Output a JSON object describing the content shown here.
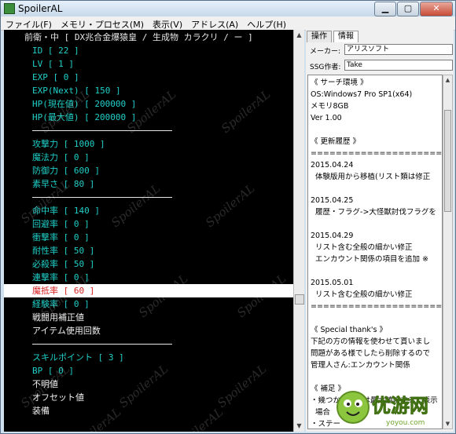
{
  "window": {
    "title": "SpoilerAL",
    "min_label": "▁",
    "max_label": "▢",
    "close_label": "✕"
  },
  "menubar": [
    "ファイル(F)",
    "メモリ・プロセス(M)",
    "表示(V)",
    "アドレス(A)",
    "ヘルプ(H)"
  ],
  "left_panel": {
    "rows": [
      {
        "kind": "header",
        "text": "前衛・中 [ DX兆合金爆猿皇 / 生成物 カラクリ / ー ]"
      },
      {
        "kind": "stat",
        "text": "ID [ 22 ]"
      },
      {
        "kind": "stat",
        "text": "LV [ 1 ]"
      },
      {
        "kind": "stat",
        "text": "EXP [ 0 ]"
      },
      {
        "kind": "stat",
        "text": "EXP(Next) [ 150 ]"
      },
      {
        "kind": "stat",
        "text": "HP(現在値) [ 200000 ]"
      },
      {
        "kind": "stat",
        "text": "HP(最大値) [ 200000 ]"
      },
      {
        "kind": "sep",
        "text": ""
      },
      {
        "kind": "stat",
        "text": "攻撃力 [ 1000 ]"
      },
      {
        "kind": "stat",
        "text": "魔法力 [ 0 ]"
      },
      {
        "kind": "stat",
        "text": "防御力 [ 600 ]"
      },
      {
        "kind": "stat",
        "text": "素早さ [ 80 ]"
      },
      {
        "kind": "sep",
        "text": ""
      },
      {
        "kind": "stat",
        "text": "命中率 [ 140 ]"
      },
      {
        "kind": "stat",
        "text": "回避率 [ 0 ]"
      },
      {
        "kind": "stat",
        "text": "衝撃率 [ 0 ]"
      },
      {
        "kind": "stat",
        "text": "耐性率 [ 50 ]"
      },
      {
        "kind": "stat",
        "text": "必殺率 [ 50 ]"
      },
      {
        "kind": "stat",
        "text": "連撃率 [ 0 ]"
      },
      {
        "kind": "selected",
        "text": "魔抵率 [ 60 ]"
      },
      {
        "kind": "stat",
        "text": "経験率 [ 0 ]"
      },
      {
        "kind": "plain",
        "text": "戦闘用補正値"
      },
      {
        "kind": "plain",
        "text": "アイテム使用回数"
      },
      {
        "kind": "sep",
        "text": ""
      },
      {
        "kind": "stat",
        "text": "スキルポイント [ 3 ]"
      },
      {
        "kind": "stat",
        "text": "BP [ 0 ]"
      },
      {
        "kind": "plain",
        "text": "不明値"
      },
      {
        "kind": "plain",
        "text": "オフセット値"
      },
      {
        "kind": "plain",
        "text": "装備"
      }
    ],
    "watermark": "SpoilerAL"
  },
  "right_panel": {
    "tabs": [
      {
        "label": "操作",
        "active": false
      },
      {
        "label": "情報",
        "active": true
      }
    ],
    "maker_label": "メーカー:",
    "maker_value": "アリスソフト",
    "ssg_label": "SSG作者:",
    "ssg_value": "Take",
    "notes": [
      "《 サーチ環境 》",
      "OS:Windows7 Pro SP1(x64)",
      "メモリ8GB",
      "Ver 1.00",
      "",
      "《 更新履歴 》",
      "=================================",
      "2015.04.24",
      "  体験版用から移植(リスト類は修正",
      "",
      "2015.04.25",
      "  履歴・フラグ->大怪獣討伐フラグを",
      "",
      "2015.04.29",
      "  リスト含む全般の細かい修正",
      "  エンカウント関係の項目を追加 ※",
      "",
      "2015.05.01",
      "  リスト含む全般の細かい修正",
      "=================================",
      "",
      "《 Special thank's 》",
      "下記の方の情報を使わせて貰いまし",
      "問題がある様でしたら削除するので",
      "管理人さん:エンカウント関係",
      "",
      "《 補足 》",
      "・幾つかの項目は最大値にすると表示",
      "  場合",
      "・ステー"
    ]
  },
  "logo": {
    "text": "优游网",
    "sub": "yoyou.com",
    "accent": "#8cc63f"
  }
}
